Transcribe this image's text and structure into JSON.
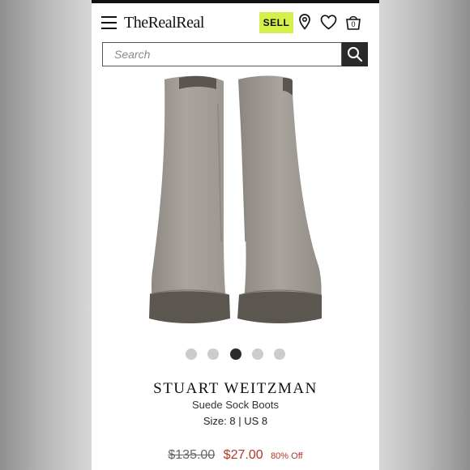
{
  "header": {
    "logo": "TheRealReal",
    "sell_label": "SELL",
    "bag_count": "0"
  },
  "search": {
    "placeholder": "Search"
  },
  "gallery": {
    "dot_count": 5,
    "active_index": 2
  },
  "product": {
    "brand": "STUART WEITZMAN",
    "name": "Suede Sock Boots",
    "size": "Size: 8 | US 8",
    "original_price": "$135.00",
    "sale_price": "$27.00",
    "discount": "80% Off"
  },
  "colors": {
    "sell_bg": "#d4f04a",
    "sale_red": "#b3362b",
    "boot_suede": "#a39d97"
  },
  "icons": [
    "hamburger-icon",
    "location-pin-icon",
    "heart-icon",
    "shopping-bag-icon",
    "search-icon"
  ]
}
